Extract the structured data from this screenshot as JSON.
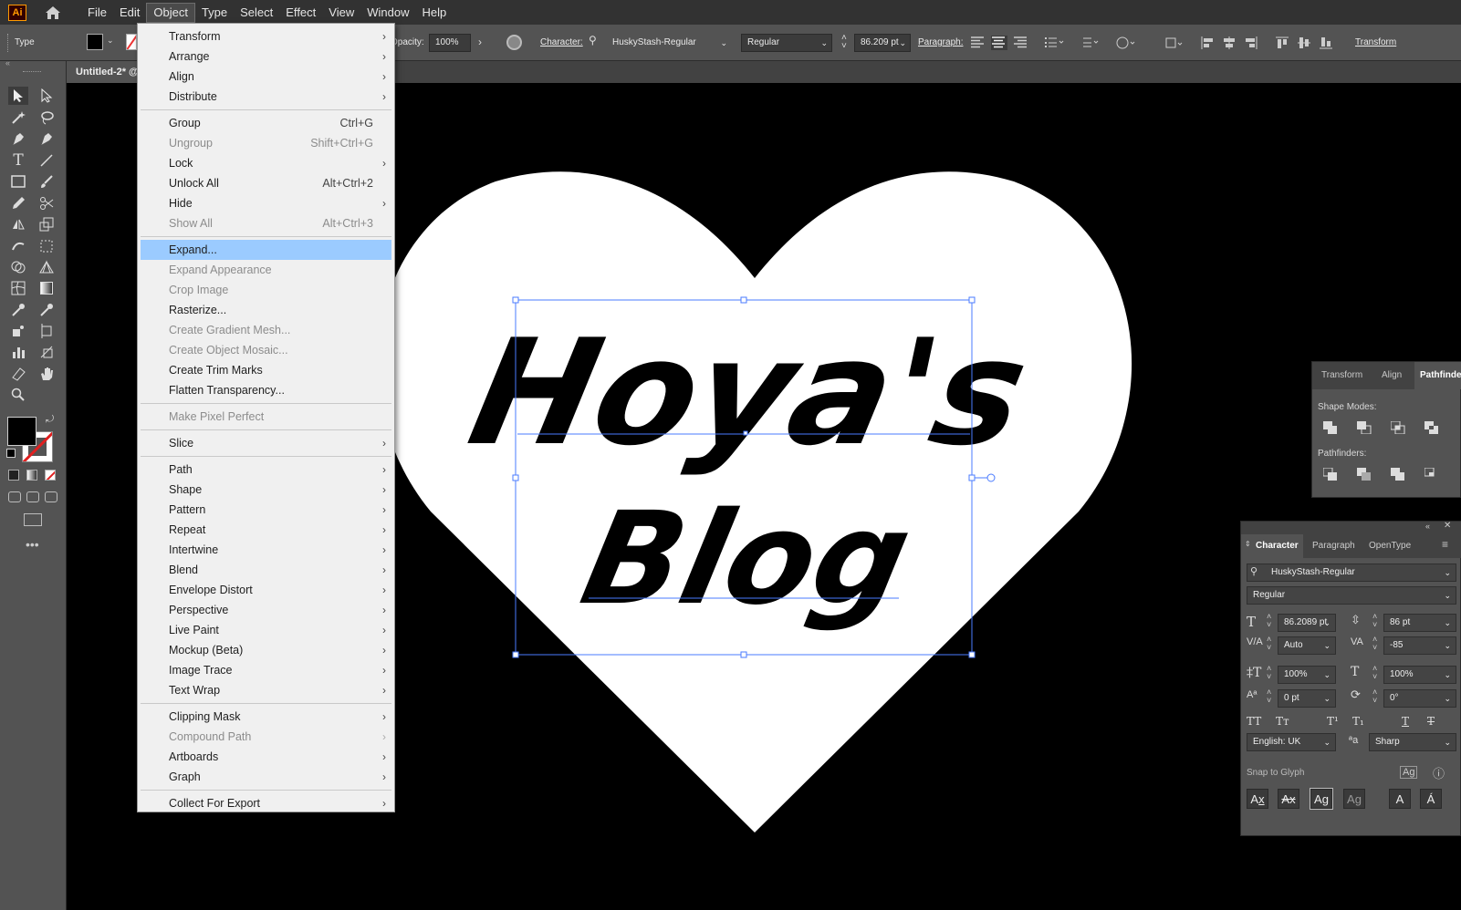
{
  "app": {
    "logo": "Ai",
    "home_icon": "home-icon"
  },
  "menubar": {
    "items": [
      "File",
      "Edit",
      "Object",
      "Type",
      "Select",
      "Effect",
      "View",
      "Window",
      "Help"
    ],
    "active": "Object"
  },
  "control_bar": {
    "tool_label": "Type",
    "opacity_label": "Opacity:",
    "opacity_value": "100%",
    "character_label": "Character:",
    "font_family": "HuskyStash-Regular",
    "font_style": "Regular",
    "font_size": "86.209 pt",
    "paragraph_label": "Paragraph:",
    "transform_label": "Transform"
  },
  "document": {
    "tab_title": "Untitled-2* @"
  },
  "artwork": {
    "line1": "Hoya's",
    "line2": "Blog",
    "colors": {
      "background": "#000000",
      "heart": "#ffffff",
      "text": "#000000",
      "selection": "#4a7bff"
    }
  },
  "object_menu": {
    "items": [
      {
        "label": "Transform",
        "shortcut": "",
        "submenu": true,
        "disabled": false
      },
      {
        "label": "Arrange",
        "shortcut": "",
        "submenu": true,
        "disabled": false
      },
      {
        "label": "Align",
        "shortcut": "",
        "submenu": true,
        "disabled": false
      },
      {
        "label": "Distribute",
        "shortcut": "",
        "submenu": true,
        "disabled": false
      },
      {
        "sep": true
      },
      {
        "label": "Group",
        "shortcut": "Ctrl+G",
        "submenu": false,
        "disabled": false
      },
      {
        "label": "Ungroup",
        "shortcut": "Shift+Ctrl+G",
        "submenu": false,
        "disabled": true
      },
      {
        "label": "Lock",
        "shortcut": "",
        "submenu": true,
        "disabled": false
      },
      {
        "label": "Unlock All",
        "shortcut": "Alt+Ctrl+2",
        "submenu": false,
        "disabled": false
      },
      {
        "label": "Hide",
        "shortcut": "",
        "submenu": true,
        "disabled": false
      },
      {
        "label": "Show All",
        "shortcut": "Alt+Ctrl+3",
        "submenu": false,
        "disabled": true
      },
      {
        "sep": true
      },
      {
        "label": "Expand...",
        "shortcut": "",
        "submenu": false,
        "disabled": false,
        "highlighted": true
      },
      {
        "label": "Expand Appearance",
        "shortcut": "",
        "submenu": false,
        "disabled": true
      },
      {
        "label": "Crop Image",
        "shortcut": "",
        "submenu": false,
        "disabled": true
      },
      {
        "label": "Rasterize...",
        "shortcut": "",
        "submenu": false,
        "disabled": false
      },
      {
        "label": "Create Gradient Mesh...",
        "shortcut": "",
        "submenu": false,
        "disabled": true
      },
      {
        "label": "Create Object Mosaic...",
        "shortcut": "",
        "submenu": false,
        "disabled": true
      },
      {
        "label": "Create Trim Marks",
        "shortcut": "",
        "submenu": false,
        "disabled": false
      },
      {
        "label": "Flatten Transparency...",
        "shortcut": "",
        "submenu": false,
        "disabled": false
      },
      {
        "sep": true
      },
      {
        "label": "Make Pixel Perfect",
        "shortcut": "",
        "submenu": false,
        "disabled": true
      },
      {
        "sep": true
      },
      {
        "label": "Slice",
        "shortcut": "",
        "submenu": true,
        "disabled": false
      },
      {
        "sep": true
      },
      {
        "label": "Path",
        "shortcut": "",
        "submenu": true,
        "disabled": false
      },
      {
        "label": "Shape",
        "shortcut": "",
        "submenu": true,
        "disabled": false
      },
      {
        "label": "Pattern",
        "shortcut": "",
        "submenu": true,
        "disabled": false
      },
      {
        "label": "Repeat",
        "shortcut": "",
        "submenu": true,
        "disabled": false
      },
      {
        "label": "Intertwine",
        "shortcut": "",
        "submenu": true,
        "disabled": false
      },
      {
        "label": "Blend",
        "shortcut": "",
        "submenu": true,
        "disabled": false
      },
      {
        "label": "Envelope Distort",
        "shortcut": "",
        "submenu": true,
        "disabled": false
      },
      {
        "label": "Perspective",
        "shortcut": "",
        "submenu": true,
        "disabled": false
      },
      {
        "label": "Live Paint",
        "shortcut": "",
        "submenu": true,
        "disabled": false
      },
      {
        "label": "Mockup (Beta)",
        "shortcut": "",
        "submenu": true,
        "disabled": false
      },
      {
        "label": "Image Trace",
        "shortcut": "",
        "submenu": true,
        "disabled": false
      },
      {
        "label": "Text Wrap",
        "shortcut": "",
        "submenu": true,
        "disabled": false
      },
      {
        "sep": true
      },
      {
        "label": "Clipping Mask",
        "shortcut": "",
        "submenu": true,
        "disabled": false
      },
      {
        "label": "Compound Path",
        "shortcut": "",
        "submenu": true,
        "disabled": true
      },
      {
        "label": "Artboards",
        "shortcut": "",
        "submenu": true,
        "disabled": false
      },
      {
        "label": "Graph",
        "shortcut": "",
        "submenu": true,
        "disabled": false
      },
      {
        "sep": true
      },
      {
        "label": "Collect For Export",
        "shortcut": "",
        "submenu": true,
        "disabled": false
      }
    ]
  },
  "pathfinder_panel": {
    "tabs": [
      "Transform",
      "Align",
      "Pathfinder"
    ],
    "active_tab": "Pathfinder",
    "shape_modes_label": "Shape Modes:",
    "pathfinders_label": "Pathfinders:"
  },
  "character_panel": {
    "tabs": [
      "Character",
      "Paragraph",
      "OpenType"
    ],
    "font_family": "HuskyStash-Regular",
    "font_style": "Regular",
    "font_size": "86.2089 pt",
    "leading": "86 pt",
    "kerning": "Auto",
    "tracking": "-85",
    "vertical_scale": "100%",
    "horizontal_scale": "100%",
    "baseline_shift": "0 pt",
    "rotation": "0°",
    "language": "English: UK",
    "antialias": "Sharp",
    "snap_to_glyph": "Snap to Glyph",
    "aa_label": "ªa"
  }
}
